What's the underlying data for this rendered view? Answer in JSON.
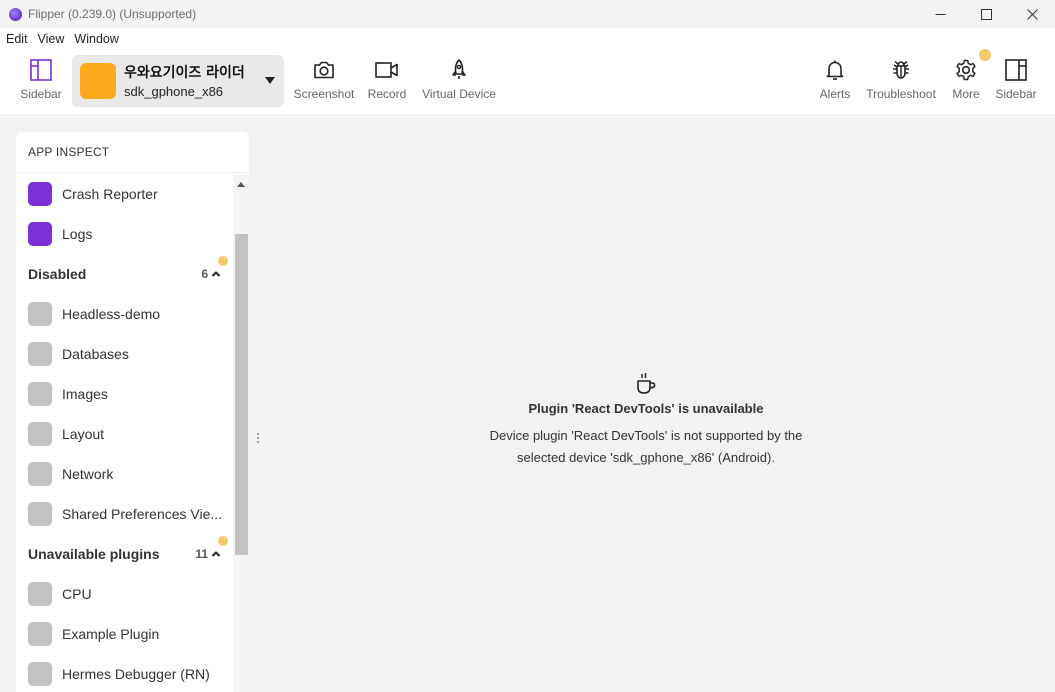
{
  "window": {
    "title": "Flipper (0.239.0) (Unsupported)"
  },
  "menu": [
    "Edit",
    "View",
    "Window"
  ],
  "toolbar": {
    "left_sidebar_label": "Sidebar",
    "device": {
      "name": "우와요기이즈 라이더",
      "id": "sdk_gphone_x86",
      "color": "#fbaa1d"
    },
    "screenshot_label": "Screenshot",
    "record_label": "Record",
    "virtual_device_label": "Virtual Device",
    "alerts_label": "Alerts",
    "troubleshoot_label": "Troubleshoot",
    "more_label": "More",
    "right_sidebar_label": "Sidebar"
  },
  "panel": {
    "header": "APP INSPECT",
    "enabled": [
      "Crash Reporter",
      "Logs"
    ],
    "disabled": {
      "title": "Disabled",
      "count": "6",
      "items": [
        "Headless-demo",
        "Databases",
        "Images",
        "Layout",
        "Network",
        "Shared Preferences Vie..."
      ]
    },
    "unavailable": {
      "title": "Unavailable plugins",
      "count": "11",
      "items": [
        "CPU",
        "Example Plugin",
        "Hermes Debugger (RN)"
      ]
    }
  },
  "message": {
    "title": "Plugin 'React DevTools' is unavailable",
    "line1": "Device plugin 'React DevTools' is not supported by the",
    "line2": "selected device 'sdk_gphone_x86' (Android)."
  },
  "colors": {
    "accent": "#7b2fd6",
    "device_swatch": "#fbaa1d",
    "notification": "#f5c96a",
    "disabled_icon": "#c3c3c3"
  }
}
